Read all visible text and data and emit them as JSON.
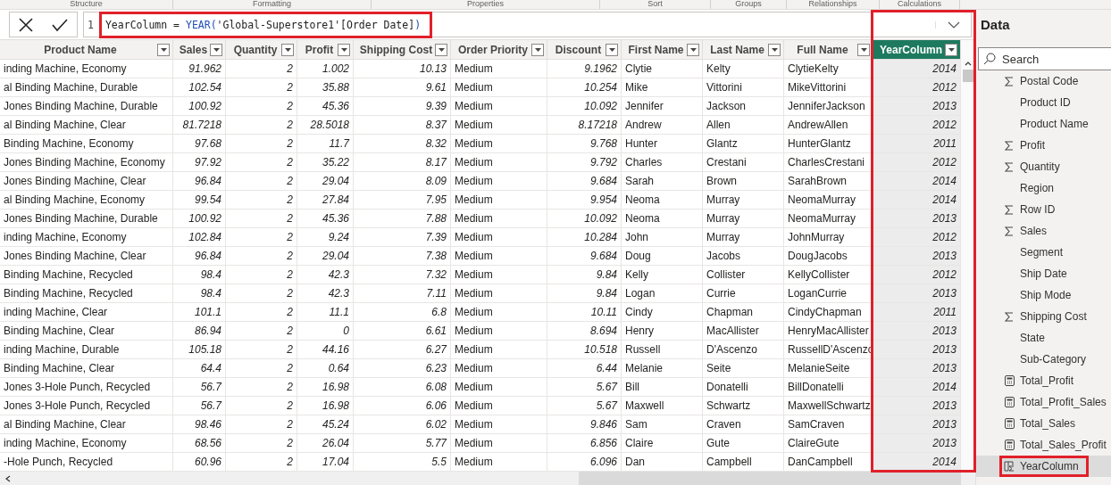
{
  "ribbon_groups": [
    "Structure",
    "Formatting",
    "Properties",
    "Sort",
    "Groups",
    "Relationships",
    "Calculations"
  ],
  "formula_bar": {
    "line_number": "1",
    "highlighted": true,
    "tokens": [
      {
        "text": "YearColumn = ",
        "kind": "plain"
      },
      {
        "text": "YEAR(",
        "kind": "function"
      },
      {
        "text": "'Global-Superstore1'[Order Date]",
        "kind": "plain"
      },
      {
        "text": ")",
        "kind": "function"
      }
    ]
  },
  "table": {
    "columns": [
      {
        "label": "Product Name",
        "kind": "text",
        "selected": false,
        "highlighted": false
      },
      {
        "label": "Sales",
        "kind": "number",
        "selected": false,
        "highlighted": false
      },
      {
        "label": "Quantity",
        "kind": "number",
        "selected": false,
        "highlighted": false
      },
      {
        "label": "Profit",
        "kind": "number",
        "selected": false,
        "highlighted": false
      },
      {
        "label": "Shipping Cost",
        "kind": "number",
        "selected": false,
        "highlighted": false
      },
      {
        "label": "Order Priority",
        "kind": "text",
        "selected": false,
        "highlighted": false
      },
      {
        "label": "Discount",
        "kind": "number",
        "selected": false,
        "highlighted": false
      },
      {
        "label": "First Name",
        "kind": "text",
        "selected": false,
        "highlighted": false
      },
      {
        "label": "Last Name",
        "kind": "text",
        "selected": false,
        "highlighted": false
      },
      {
        "label": "Full Name",
        "kind": "text",
        "selected": false,
        "highlighted": false
      },
      {
        "label": "YearColumn",
        "kind": "number",
        "selected": true,
        "highlighted": true
      }
    ],
    "rows": [
      [
        "inding Machine, Economy",
        "91.962",
        "2",
        "1.002",
        "10.13",
        "Medium",
        "9.1962",
        "Clytie",
        "Kelty",
        "ClytieKelty",
        "2014"
      ],
      [
        "al Binding Machine, Durable",
        "102.54",
        "2",
        "35.88",
        "9.61",
        "Medium",
        "10.254",
        "Mike",
        "Vittorini",
        "MikeVittorini",
        "2012"
      ],
      [
        "Jones Binding Machine, Durable",
        "100.92",
        "2",
        "45.36",
        "9.39",
        "Medium",
        "10.092",
        "Jennifer",
        "Jackson",
        "JenniferJackson",
        "2013"
      ],
      [
        "al Binding Machine, Clear",
        "81.7218",
        "2",
        "28.5018",
        "8.37",
        "Medium",
        "8.17218",
        "Andrew",
        "Allen",
        "AndrewAllen",
        "2012"
      ],
      [
        "Binding Machine, Economy",
        "97.68",
        "2",
        "11.7",
        "8.32",
        "Medium",
        "9.768",
        "Hunter",
        "Glantz",
        "HunterGlantz",
        "2011"
      ],
      [
        "Jones Binding Machine, Economy",
        "97.92",
        "2",
        "35.22",
        "8.17",
        "Medium",
        "9.792",
        "Charles",
        "Crestani",
        "CharlesCrestani",
        "2012"
      ],
      [
        "Jones Binding Machine, Clear",
        "96.84",
        "2",
        "29.04",
        "8.09",
        "Medium",
        "9.684",
        "Sarah",
        "Brown",
        "SarahBrown",
        "2014"
      ],
      [
        "al Binding Machine, Economy",
        "99.54",
        "2",
        "27.84",
        "7.95",
        "Medium",
        "9.954",
        "Neoma",
        "Murray",
        "NeomaMurray",
        "2014"
      ],
      [
        "Jones Binding Machine, Durable",
        "100.92",
        "2",
        "45.36",
        "7.88",
        "Medium",
        "10.092",
        "Neoma",
        "Murray",
        "NeomaMurray",
        "2013"
      ],
      [
        "inding Machine, Economy",
        "102.84",
        "2",
        "9.24",
        "7.39",
        "Medium",
        "10.284",
        "John",
        "Murray",
        "JohnMurray",
        "2012"
      ],
      [
        "Jones Binding Machine, Clear",
        "96.84",
        "2",
        "29.04",
        "7.38",
        "Medium",
        "9.684",
        "Doug",
        "Jacobs",
        "DougJacobs",
        "2013"
      ],
      [
        "Binding Machine, Recycled",
        "98.4",
        "2",
        "42.3",
        "7.32",
        "Medium",
        "9.84",
        "Kelly",
        "Collister",
        "KellyCollister",
        "2012"
      ],
      [
        "Binding Machine, Recycled",
        "98.4",
        "2",
        "42.3",
        "7.11",
        "Medium",
        "9.84",
        "Logan",
        "Currie",
        "LoganCurrie",
        "2013"
      ],
      [
        "inding Machine, Clear",
        "101.1",
        "2",
        "11.1",
        "6.8",
        "Medium",
        "10.11",
        "Cindy",
        "Chapman",
        "CindyChapman",
        "2011"
      ],
      [
        "Binding Machine, Clear",
        "86.94",
        "2",
        "0",
        "6.61",
        "Medium",
        "8.694",
        "Henry",
        "MacAllister",
        "HenryMacAllister",
        "2013"
      ],
      [
        "inding Machine, Durable",
        "105.18",
        "2",
        "44.16",
        "6.27",
        "Medium",
        "10.518",
        "Russell",
        "D'Ascenzo",
        "RussellD'Ascenzo",
        "2013"
      ],
      [
        "Binding Machine, Clear",
        "64.4",
        "2",
        "0.64",
        "6.23",
        "Medium",
        "6.44",
        "Melanie",
        "Seite",
        "MelanieSeite",
        "2013"
      ],
      [
        "Jones 3-Hole Punch, Recycled",
        "56.7",
        "2",
        "16.98",
        "6.08",
        "Medium",
        "5.67",
        "Bill",
        "Donatelli",
        "BillDonatelli",
        "2014"
      ],
      [
        "Jones 3-Hole Punch, Recycled",
        "56.7",
        "2",
        "16.98",
        "6.06",
        "Medium",
        "5.67",
        "Maxwell",
        "Schwartz",
        "MaxwellSchwartz",
        "2013"
      ],
      [
        "al Binding Machine, Clear",
        "98.46",
        "2",
        "45.24",
        "6.02",
        "Medium",
        "9.846",
        "Sam",
        "Craven",
        "SamCraven",
        "2013"
      ],
      [
        "inding Machine, Economy",
        "68.56",
        "2",
        "26.04",
        "5.77",
        "Medium",
        "6.856",
        "Claire",
        "Gute",
        "ClaireGute",
        "2013"
      ],
      [
        "-Hole Punch, Recycled",
        "60.96",
        "2",
        "17.04",
        "5.5",
        "Medium",
        "6.096",
        "Dan",
        "Campbell",
        "DanCampbell",
        "2014"
      ]
    ]
  },
  "data_pane": {
    "title": "Data",
    "search": {
      "placeholder": "Search"
    },
    "fields": [
      {
        "label": "Postal Code",
        "kind": "sum",
        "selected": false,
        "highlighted": false
      },
      {
        "label": "Product ID",
        "kind": "text",
        "selected": false,
        "highlighted": false
      },
      {
        "label": "Product Name",
        "kind": "text",
        "selected": false,
        "highlighted": false
      },
      {
        "label": "Profit",
        "kind": "sum",
        "selected": false,
        "highlighted": false
      },
      {
        "label": "Quantity",
        "kind": "sum",
        "selected": false,
        "highlighted": false
      },
      {
        "label": "Region",
        "kind": "text",
        "selected": false,
        "highlighted": false
      },
      {
        "label": "Row ID",
        "kind": "sum",
        "selected": false,
        "highlighted": false
      },
      {
        "label": "Sales",
        "kind": "sum",
        "selected": false,
        "highlighted": false
      },
      {
        "label": "Segment",
        "kind": "text",
        "selected": false,
        "highlighted": false
      },
      {
        "label": "Ship Date",
        "kind": "text",
        "selected": false,
        "highlighted": false
      },
      {
        "label": "Ship Mode",
        "kind": "text",
        "selected": false,
        "highlighted": false
      },
      {
        "label": "Shipping Cost",
        "kind": "sum",
        "selected": false,
        "highlighted": false
      },
      {
        "label": "State",
        "kind": "text",
        "selected": false,
        "highlighted": false
      },
      {
        "label": "Sub-Category",
        "kind": "text",
        "selected": false,
        "highlighted": false
      },
      {
        "label": "Total_Profit",
        "kind": "measure",
        "selected": false,
        "highlighted": false
      },
      {
        "label": "Total_Profit_Sales",
        "kind": "measure",
        "selected": false,
        "highlighted": false
      },
      {
        "label": "Total_Sales",
        "kind": "measure",
        "selected": false,
        "highlighted": false
      },
      {
        "label": "Total_Sales_Profit",
        "kind": "measure",
        "selected": false,
        "highlighted": false
      },
      {
        "label": "YearColumn",
        "kind": "calculated",
        "selected": true,
        "highlighted": true
      }
    ]
  }
}
